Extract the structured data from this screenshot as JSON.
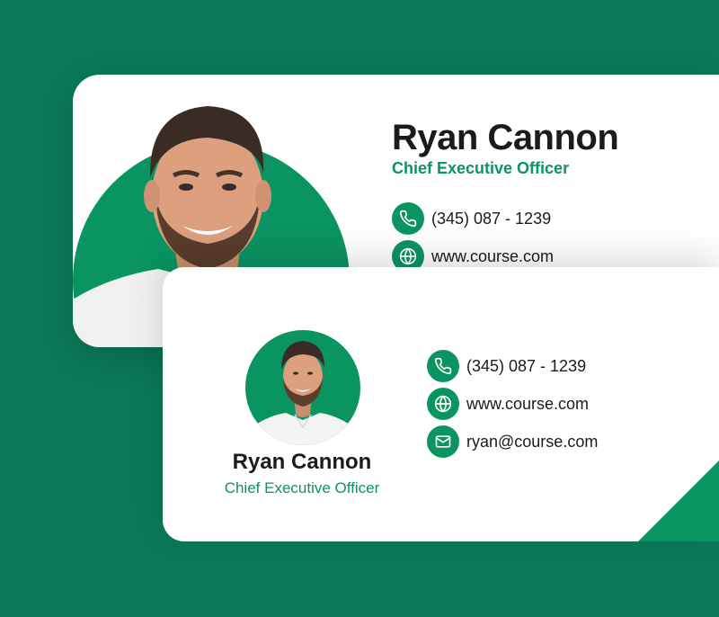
{
  "colors": {
    "background": "#0a7a58",
    "accent": "#0a9462",
    "card": "#ffffff",
    "text": "#1b1b1b"
  },
  "back_card": {
    "name": "Ryan Cannon",
    "title": "Chief Executive Officer",
    "phone": "(345) 087 - 1239",
    "website": "www.course.com"
  },
  "front_card": {
    "name": "Ryan Cannon",
    "title": "Chief Executive Officer",
    "phone": "(345) 087 - 1239",
    "website": "www.course.com",
    "email": "ryan@course.com"
  },
  "icons": {
    "phone": "phone-icon",
    "website": "globe-icon",
    "email": "mail-icon"
  }
}
